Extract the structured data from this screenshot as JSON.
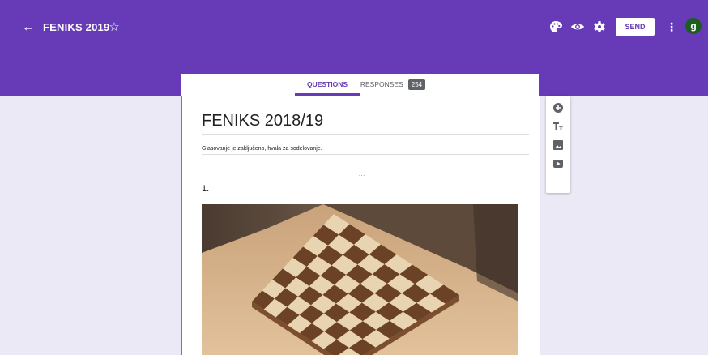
{
  "header": {
    "form_name": "FENIKS 2019",
    "send_label": "SEND",
    "avatar_initial": "g",
    "icons": [
      "back-arrow-icon",
      "star-icon",
      "palette-icon",
      "eye-icon",
      "gear-icon",
      "more-vert-icon"
    ]
  },
  "tabs": [
    {
      "label": "QUESTIONS",
      "active": true
    },
    {
      "label": "RESPONSES",
      "count": "254"
    }
  ],
  "form": {
    "title": "FENIKS 2018/19",
    "description": "Glasovanje je zaključeno, hvala za sodelovanje.",
    "question_number": "1.",
    "question_image": "chessboard-photo"
  },
  "side_toolbar": [
    "add-question-icon",
    "title-text-icon",
    "add-image-icon",
    "add-video-icon"
  ],
  "colors": {
    "accent": "#673ab7",
    "background": "#ece9f6",
    "card": "#ffffff",
    "focus": "#4285f4"
  }
}
